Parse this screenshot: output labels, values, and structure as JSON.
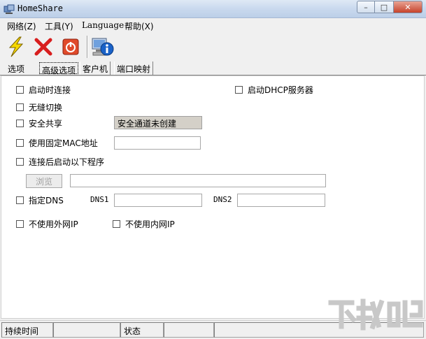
{
  "window": {
    "title": "HomeShare"
  },
  "menu": {
    "network": "网络(Z)",
    "tools": "工具(Y)",
    "language": "Language",
    "help": "帮助(X)"
  },
  "toolbar": {
    "connect_icon": "lightning-icon",
    "stop_icon": "red-x-icon",
    "power_icon": "power-icon",
    "info_icon": "computer-info-icon"
  },
  "tabs": [
    "选项",
    "高级选项",
    "客户机",
    "端口映射"
  ],
  "advanced": {
    "connect_on_start": "启动时连接",
    "start_dhcp": "启动DHCP服务器",
    "seamless_switch": "无缝切换",
    "secure_share": "安全共享",
    "secure_tunnel_status": "安全通道未创建",
    "fixed_mac": "使用固定MAC地址",
    "run_program": "连接后启动以下程序",
    "browse": "浏览",
    "specify_dns": "指定DNS",
    "dns1": "DNS1",
    "dns2": "DNS2",
    "no_external_ip": "不使用外网IP",
    "no_internal_ip": "不使用内网IP"
  },
  "status": {
    "duration_label": "持续时间",
    "state_label": "状态"
  },
  "colors": {
    "accent_red": "#d81e1e",
    "lightning_yellow": "#f5d800",
    "info_blue": "#1a62c8"
  }
}
